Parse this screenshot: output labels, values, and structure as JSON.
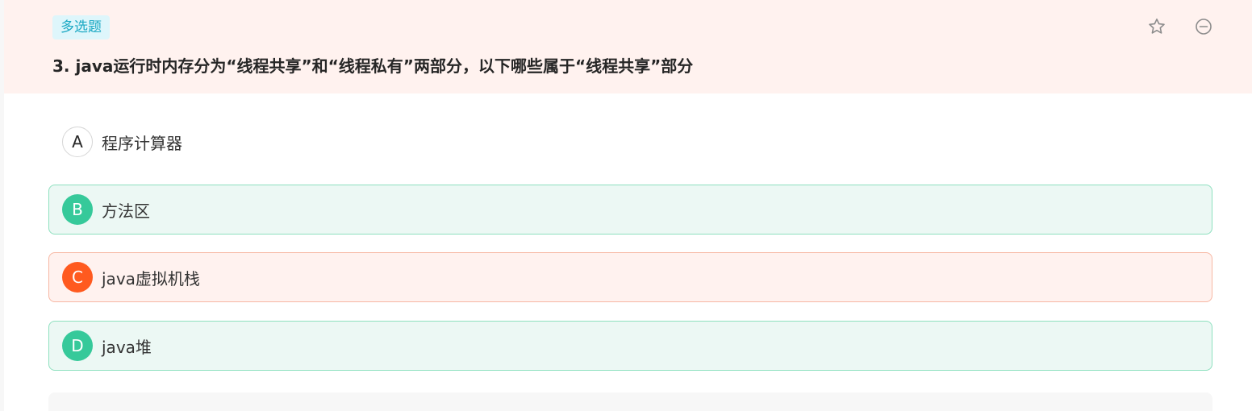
{
  "question": {
    "type_tag": "多选题",
    "title": "3. java运行时内存分为“线程共享”和“线程私有”两部分，以下哪些属于“线程共享”部分"
  },
  "toolbar": {
    "star_icon": "star-icon",
    "remove_icon": "minus-circle-icon"
  },
  "options": [
    {
      "letter": "A",
      "text": "程序计算器",
      "state": "unselected"
    },
    {
      "letter": "B",
      "text": "方法区",
      "state": "correct"
    },
    {
      "letter": "C",
      "text": "java虚拟机栈",
      "state": "wrong"
    },
    {
      "letter": "D",
      "text": "java堆",
      "state": "correct"
    }
  ],
  "colors": {
    "header_bg": "#fff2ef",
    "tag_text": "#1aa8c3",
    "tag_bg": "#def6fb",
    "correct": "#36c99a",
    "correct_bg": "#ecf8f4",
    "wrong": "#ff5a1f",
    "wrong_bg": "#fff2ef"
  }
}
